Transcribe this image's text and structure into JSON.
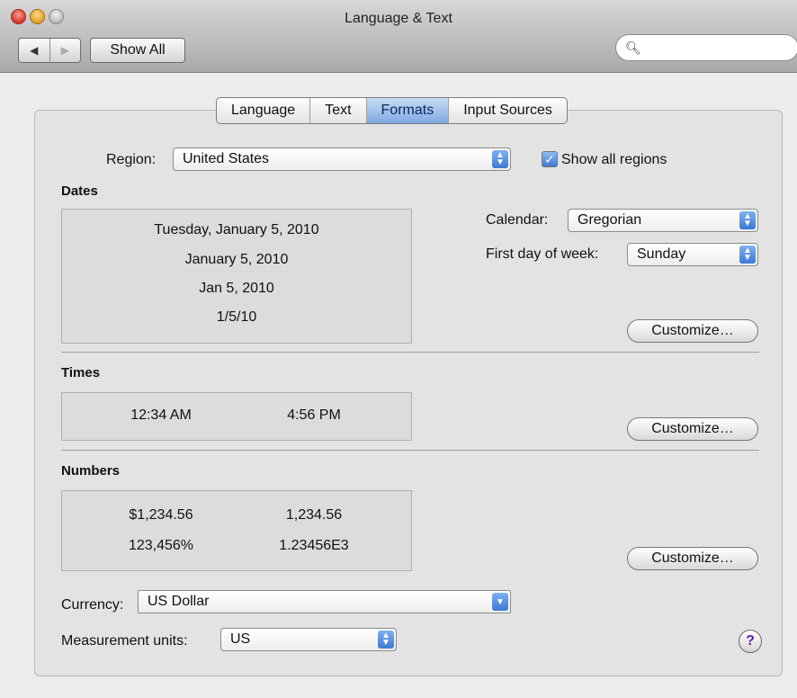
{
  "window": {
    "title": "Language & Text"
  },
  "toolbar": {
    "back_icon": "triangle-left-icon",
    "forward_icon": "triangle-right-icon",
    "show_all_label": "Show All",
    "search_icon": "magnifier-icon",
    "search_value": "",
    "search_placeholder": ""
  },
  "tabs": [
    {
      "label": "Language",
      "active": false
    },
    {
      "label": "Text",
      "active": false
    },
    {
      "label": "Formats",
      "active": true
    },
    {
      "label": "Input Sources",
      "active": false
    }
  ],
  "region": {
    "label": "Region:",
    "value": "United States",
    "show_all_regions_label": "Show all regions",
    "show_all_regions_checked": true
  },
  "dates": {
    "section_label": "Dates",
    "samples": [
      "Tuesday, January 5, 2010",
      "January 5, 2010",
      "Jan 5, 2010",
      "1/5/10"
    ],
    "calendar_label": "Calendar:",
    "calendar_value": "Gregorian",
    "first_day_label": "First day of week:",
    "first_day_value": "Sunday",
    "customize_label": "Customize…"
  },
  "times": {
    "section_label": "Times",
    "samples": [
      "12:34 AM",
      "4:56 PM"
    ],
    "customize_label": "Customize…"
  },
  "numbers": {
    "section_label": "Numbers",
    "samples": [
      "$1,234.56",
      "1,234.56",
      "123,456%",
      "1.23456E3"
    ],
    "customize_label": "Customize…"
  },
  "currency": {
    "label": "Currency:",
    "value": "US Dollar"
  },
  "measurement": {
    "label": "Measurement units:",
    "value": "US"
  },
  "help": {
    "label": "?"
  },
  "colors": {
    "accent": "#3c79d6",
    "active_tab": "#7ea8e3"
  }
}
